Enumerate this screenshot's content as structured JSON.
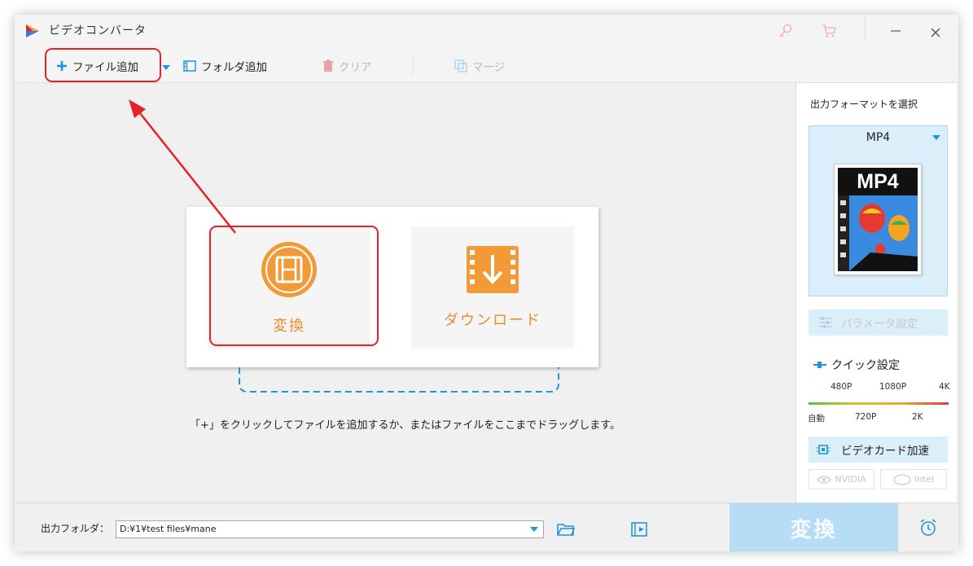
{
  "window": {
    "title": "ビデオコンバータ"
  },
  "toolbar": {
    "add_file": "ファイル追加",
    "add_folder": "フォルダ追加",
    "clear": "クリア",
    "merge": "マージ"
  },
  "main": {
    "tiles": [
      {
        "label": "変換"
      },
      {
        "label": "ダウンロード"
      }
    ],
    "hint": "「+」をクリックしてファイルを追加するか、またはファイルをここまでドラッグします。"
  },
  "sidebar": {
    "title": "出力フォーマットを選択",
    "format": "MP4",
    "format_thumb_text": "MP4",
    "params_button": "パラメータ設定",
    "quick_title": "クイック設定",
    "quality_top": [
      "480P",
      "1080P",
      "4K"
    ],
    "quality_bottom": [
      "自動",
      "720P",
      "2K"
    ],
    "gpu_title": "ビデオカード加速",
    "gpu_options": [
      "NVIDIA",
      "Intel"
    ]
  },
  "bottom": {
    "output_label": "出力フォルダ：",
    "output_path": "D:¥1¥test files¥mane",
    "convert_button": "変換"
  },
  "colors": {
    "accent_orange": "#f39a38",
    "accent_blue": "#1e96dd",
    "annotation_red": "#e8202a"
  }
}
